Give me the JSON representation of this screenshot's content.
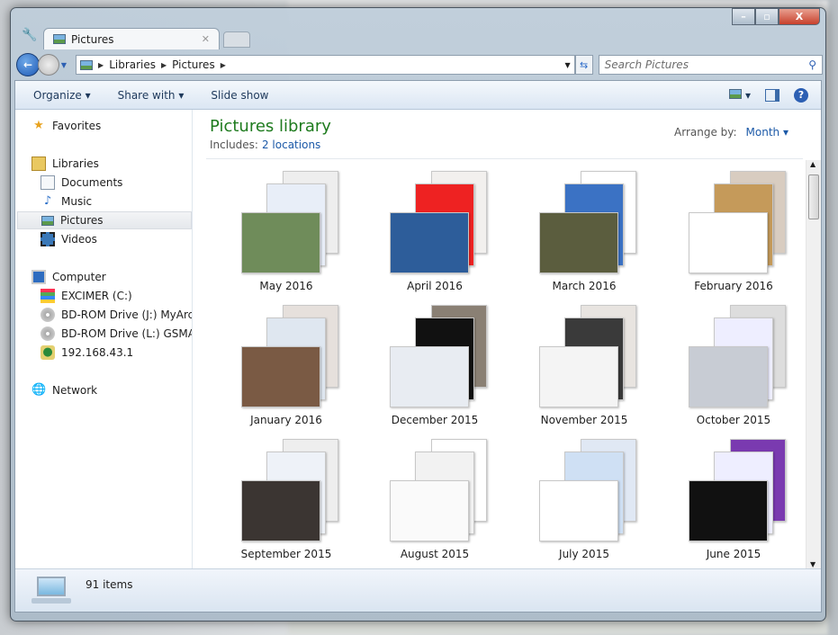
{
  "window": {
    "tab_title": "Pictures",
    "minimize": "–",
    "maximize": "▫",
    "close": "X"
  },
  "address": {
    "crumbs": [
      "Libraries",
      "Pictures"
    ],
    "search_placeholder": "Search Pictures"
  },
  "toolbar": {
    "organize": "Organize ▾",
    "share_with": "Share with ▾",
    "slide_show": "Slide show",
    "views": "▾"
  },
  "nav": {
    "favorites": "Favorites",
    "libraries": "Libraries",
    "documents": "Documents",
    "music": "Music",
    "pictures": "Pictures",
    "videos": "Videos",
    "computer": "Computer",
    "drive_c": "EXCIMER (C:)",
    "drive_j": "BD-ROM Drive (J:) MyArchi",
    "drive_l": "BD-ROM Drive (L:) GSMART",
    "ip": "192.168.43.1",
    "network": "Network"
  },
  "library": {
    "title": "Pictures library",
    "includes_label": "Includes:",
    "includes_link": "2 locations",
    "arrange_label": "Arrange by:",
    "arrange_value": "Month ▾"
  },
  "groups": [
    {
      "label": "May 2016",
      "colors": [
        "#eee",
        "#e8eef8",
        "#6f8c5a"
      ]
    },
    {
      "label": "April 2016",
      "colors": [
        "#f2f0ee",
        "#e22",
        "#2d5d9a"
      ]
    },
    {
      "label": "March 2016",
      "colors": [
        "#fff",
        "#3b72c4",
        "#5b5d3e"
      ]
    },
    {
      "label": "February 2016",
      "colors": [
        "#d8ccc0",
        "#c59a5a",
        "#fff"
      ]
    },
    {
      "label": "January 2016",
      "colors": [
        "#e6e0dc",
        "#dfe7f0",
        "#7a5a44"
      ]
    },
    {
      "label": "December 2015",
      "colors": [
        "#8a8074",
        "#111",
        "#e8ecf2"
      ]
    },
    {
      "label": "November 2015",
      "colors": [
        "#e8e4e0",
        "#3a3a3a",
        "#f4f4f4"
      ]
    },
    {
      "label": "October 2015",
      "colors": [
        "#ddd",
        "#eef",
        "#c8ccd4"
      ]
    },
    {
      "label": "September 2015",
      "colors": [
        "#eee",
        "#eef2f8",
        "#3b3532"
      ]
    },
    {
      "label": "August 2015",
      "colors": [
        "#fff",
        "#f2f2f2",
        "#fafafa"
      ]
    },
    {
      "label": "July 2015",
      "colors": [
        "#e0e8f4",
        "#cfe0f4",
        "#fff"
      ]
    },
    {
      "label": "June 2015",
      "colors": [
        "#7a3ab0",
        "#eef",
        "#111"
      ]
    }
  ],
  "status": {
    "count": "91 items"
  }
}
